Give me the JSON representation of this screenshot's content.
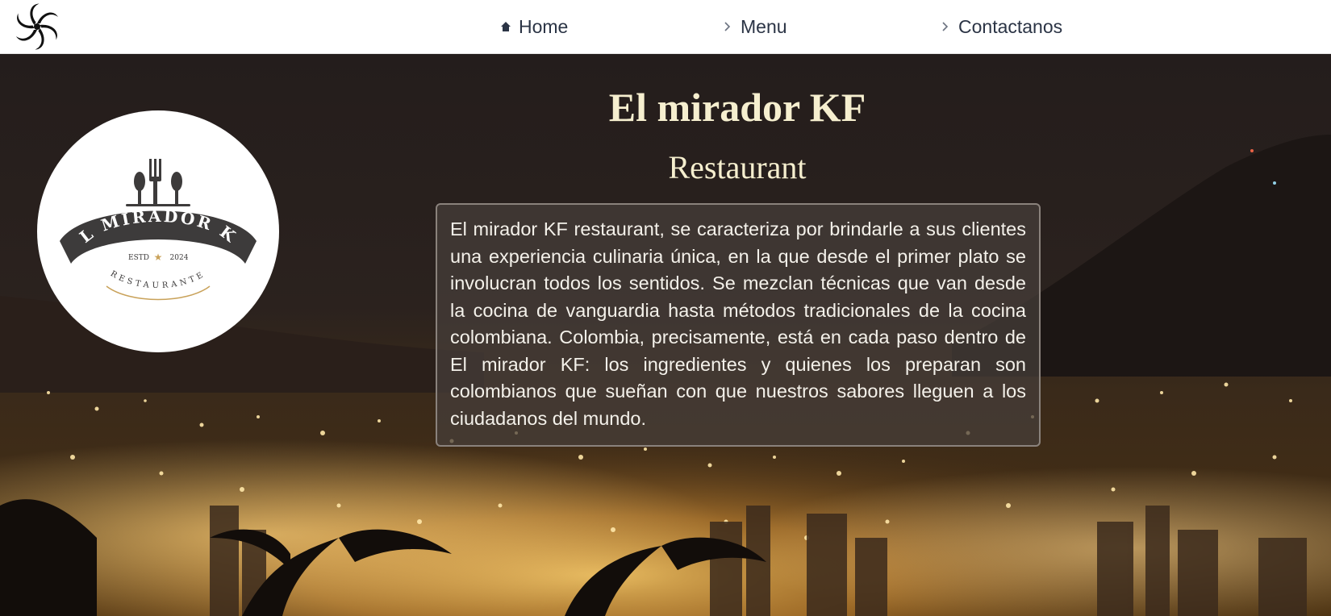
{
  "nav": {
    "brand_icon": "swirl-logo-icon",
    "items": [
      {
        "label": "Home",
        "icon": "home-icon"
      },
      {
        "label": "Menu",
        "icon": "chevron-right-icon"
      },
      {
        "label": "Contactanos",
        "icon": "chevron-right-icon"
      }
    ]
  },
  "logo": {
    "name": "EL MIRADOR KF",
    "estd_label": "ESTD",
    "year": "2024",
    "subtitle": "RESTAURANTE",
    "icon": "cutlery-icon"
  },
  "hero": {
    "title": "El mirador KF",
    "subtitle": "Restaurant",
    "description": "El mirador KF restaurant, se caracteriza por brindarle a sus clientes una experiencia culinaria única, en la que desde el primer plato se involucran todos los sentidos. Se mezclan técnicas que van desde la cocina de vanguardia hasta métodos tradicionales de la cocina colombiana. Colombia, precisamente, está en cada paso dentro de El mirador KF: los ingredientes y quienes los preparan son colombianos que sueñan con que nuestros sabores lleguen a los ciudadanos del mundo."
  },
  "colors": {
    "title": "#f6efcf",
    "nav_text": "#2b3445",
    "logo_dark": "#3d3b3b",
    "accent_gold": "#c9a25a"
  }
}
